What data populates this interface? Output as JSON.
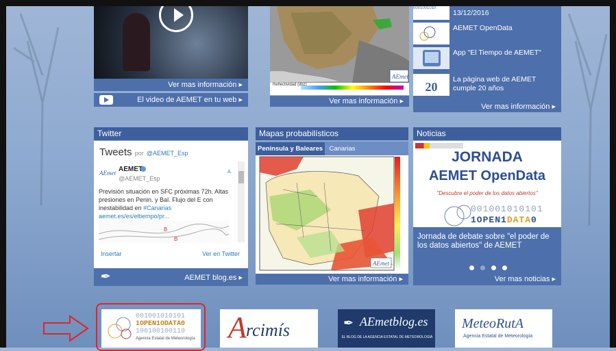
{
  "video": {
    "link": "Ver mas información",
    "bar_text": "El video de AEMET en tu web"
  },
  "map_top": {
    "link": "Ver mas información",
    "legend_title": "Reflectividad (dbz)"
  },
  "news_list": {
    "items": [
      {
        "text": "13/12/2016"
      },
      {
        "text": "AEMET OpenData"
      },
      {
        "text": "App \"El Tiempo de AEMET\""
      },
      {
        "text": "La página web de AEMET cumple 20 años"
      }
    ],
    "thumb_20": "20",
    "link": "Ver mas información"
  },
  "twitter": {
    "title": "Twitter",
    "tweets_label": "Tweets",
    "by_label": "por",
    "handle": "@AEMET_Esp",
    "account_name": "AEMET",
    "account_handle": "@AEMET_Esp",
    "tweet_text": "Previsión situación en SFC próximas 72h. Altas presiones en Penin. y Bal. Flujo del E con inestabilidad en ",
    "tweet_tag": "#Canarias",
    "tweet_link": " aemet.es/es/eltiempo/pr...",
    "insert": "Insertar",
    "view": "Ver en Twitter",
    "blog_link": "AEMET blog.es"
  },
  "mapas": {
    "title": "Mapas probabilísticos",
    "tab_active": "Península y Baleares",
    "tab_other": "Canarias",
    "link": "Ver mas información"
  },
  "noticias": {
    "title": "Noticias",
    "line1": "JORNADA",
    "line2": "AEMET OpenData",
    "quote": "\"Descubre el poder de los datos abiertos\"",
    "bits1": "001001010101",
    "bits2a": "1OPEN1",
    "bits2b": "DATA",
    "bits2c": "0",
    "caption": "Jornada de debate sobre \"el poder de los datos abiertos\" de AEMET",
    "link": "Ver mas noticias"
  },
  "logos": {
    "opendata_bits1": "001001010101",
    "opendata_bits2": "1OPEN1ODATA0",
    "opendata_bits3": "100100100110",
    "opendata_sub": "Agencia Estatal de Meteorología",
    "arcimis": "rcimís",
    "blog_name": "AEmetblog.es",
    "blog_sub": "EL BLOG DE LA AGENCIA ESTATAL DE METEOROLOGÍA",
    "meteoruta": "MeteoRutA",
    "meteoruta_sub": "Agencia Estatal de Meteorología"
  },
  "colors": {
    "panel_blue": "#4d6fab",
    "header_blue": "#3d5f9d",
    "highlight_red": "#e0242b"
  }
}
